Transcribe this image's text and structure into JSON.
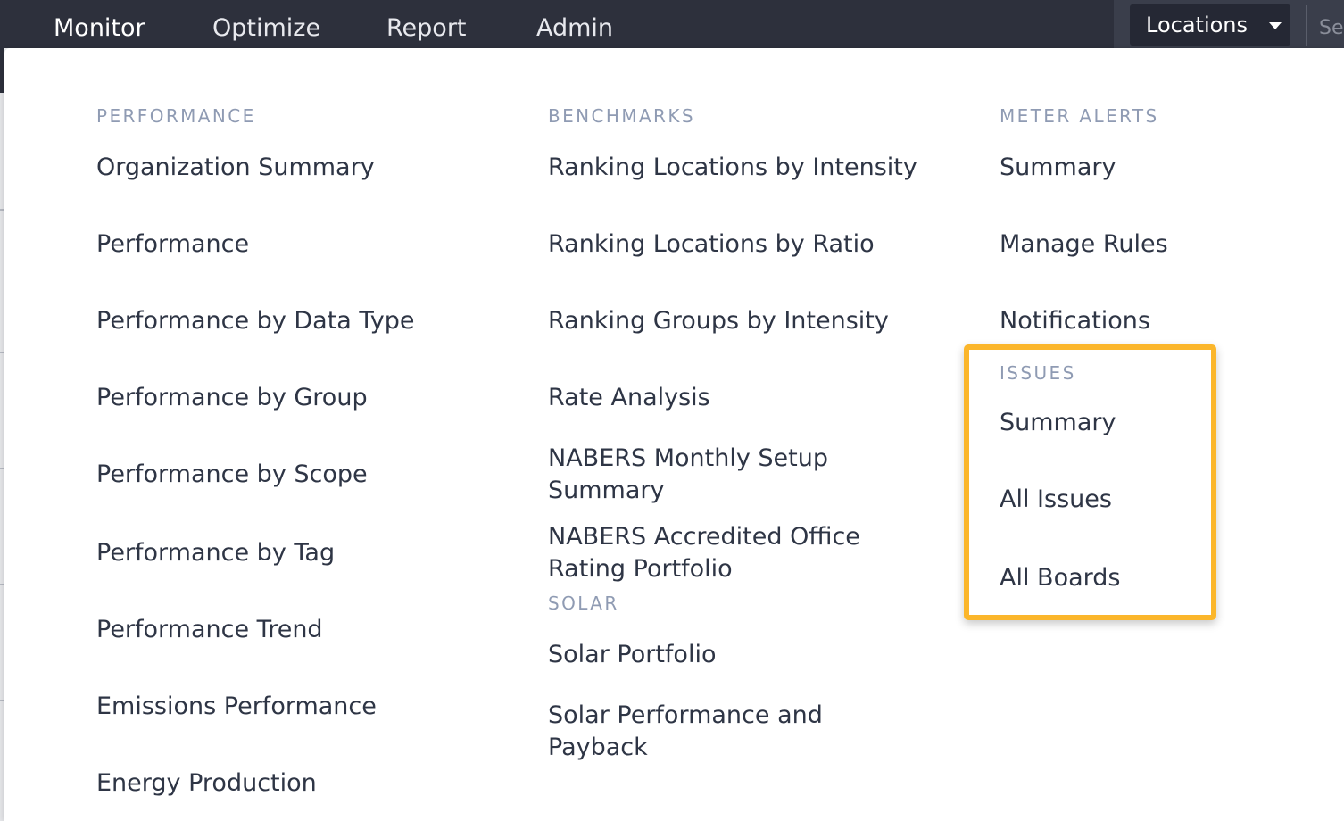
{
  "topnav": {
    "items": [
      "Monitor",
      "Optimize",
      "Report",
      "Admin"
    ],
    "locations_label": "Locations",
    "search_peek": "Se"
  },
  "menu": {
    "performance": {
      "heading": "PERFORMANCE",
      "links": [
        "Organization Summary",
        "Performance",
        "Performance by Data Type",
        "Performance by Group",
        "Performance by Scope",
        "Performance by Tag",
        "Performance Trend",
        "Emissions Performance",
        "Energy Production"
      ]
    },
    "benchmarks": {
      "heading": "BENCHMARKS",
      "links": [
        "Ranking Locations by Intensity",
        "Ranking Locations by Ratio",
        "Ranking Groups by Intensity",
        "Rate Analysis",
        "NABERS Monthly Setup Summary",
        "NABERS Accredited Office Rating Portfolio"
      ]
    },
    "solar": {
      "heading": "SOLAR",
      "links": [
        "Solar Portfolio",
        "Solar Performance and Payback"
      ]
    },
    "meter_alerts": {
      "heading": "METER ALERTS",
      "links": [
        "Summary",
        "Manage Rules",
        "Notifications"
      ]
    },
    "issues": {
      "heading": "ISSUES",
      "links": [
        "Summary",
        "All Issues",
        "All Boards"
      ]
    }
  },
  "colors": {
    "topbar": "#2d303c",
    "heading": "#8f9bb3",
    "link": "#2e3545",
    "highlight": "#fbb62b"
  }
}
